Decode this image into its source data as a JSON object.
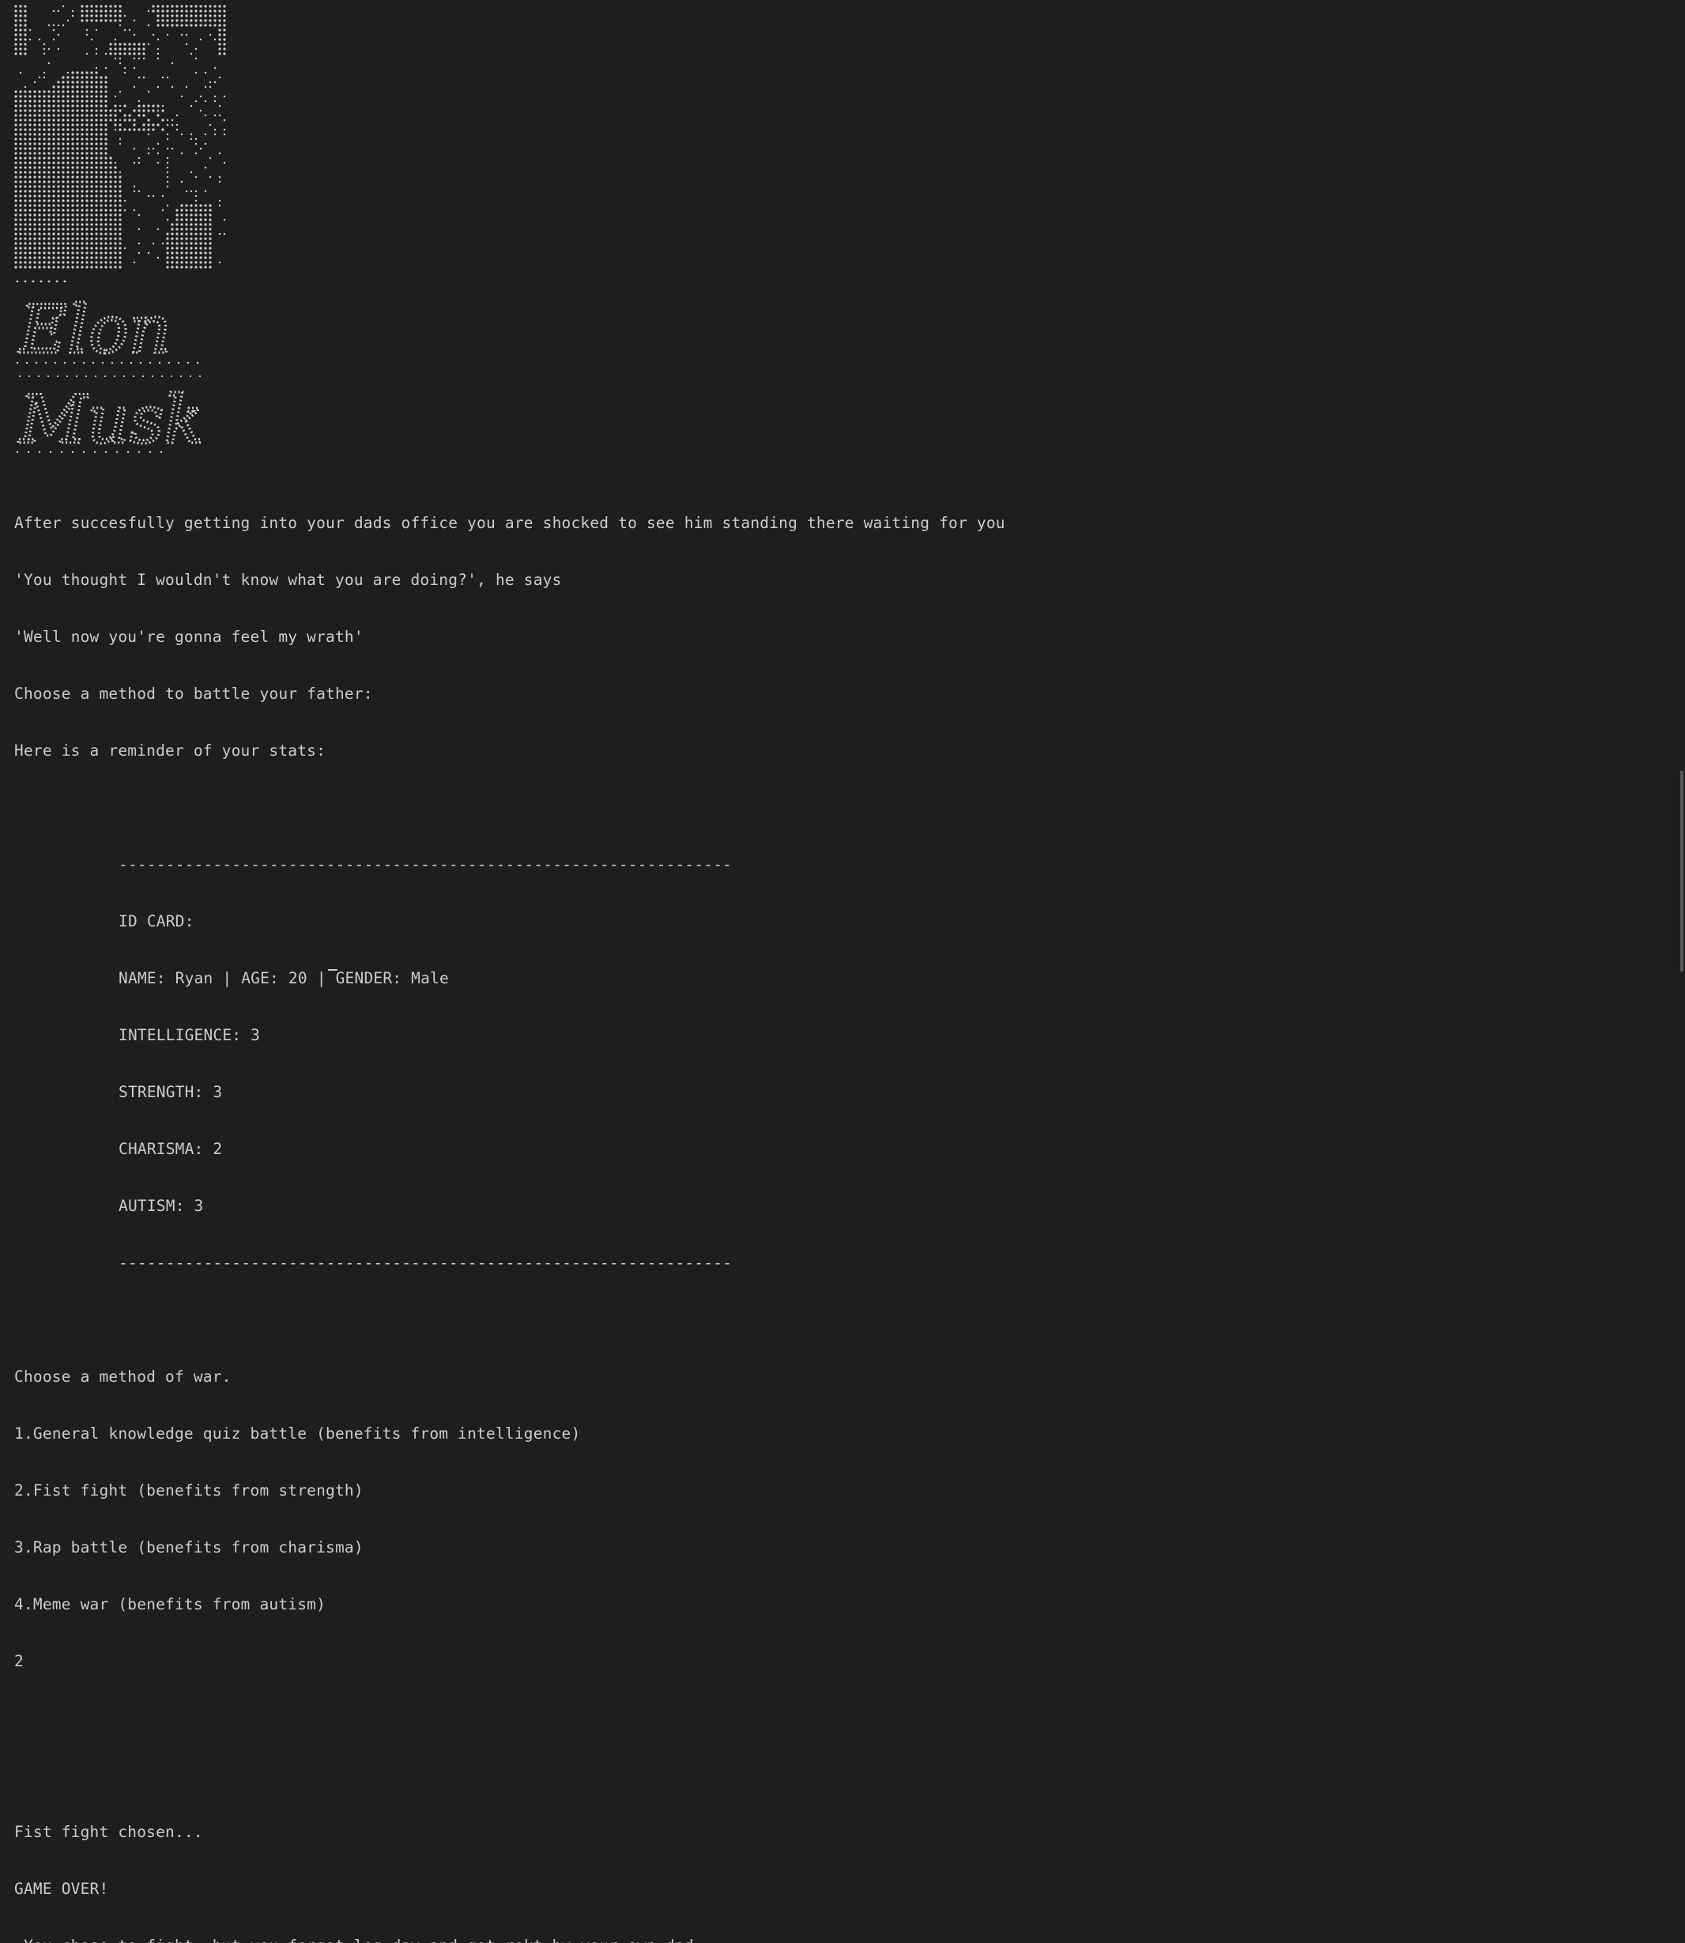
{
  "art": {
    "icon": "braille-ascii-portrait",
    "name_art_line1": "Elon",
    "name_art_line2": "Musk"
  },
  "story": {
    "line1": "After succesfully getting into your dads office you are shocked to see him standing there waiting for you",
    "line2": "'You thought I wouldn't know what you are doing?', he says",
    "line3": "'Well now you're gonna feel my wrath'",
    "line4": "Choose a method to battle your father:",
    "line5": "Here is a reminder of your stats:"
  },
  "id_card": {
    "divider": "-----------------------------------------------------------------",
    "title": "ID CARD:",
    "name_line": "NAME: Ryan | AGE: 20 | GENDER: Male",
    "intelligence": "INTELLIGENCE: 3",
    "strength": "STRENGTH: 3",
    "charisma": "CHARISMA: 2",
    "autism": "AUTISM: 3"
  },
  "menu": {
    "prompt": "Choose a method of war.",
    "options": [
      "1.General knowledge quiz battle (benefits from intelligence)",
      "2.Fist fight (benefits from strength)",
      "3.Rap battle (benefits from charisma)",
      "4.Meme war (benefits from autism)"
    ],
    "user_input": "2"
  },
  "result": {
    "chosen": "Fist fight chosen...",
    "game_over": "GAME OVER!",
    "message": " You chose to fight, but you forgot leg day and got rekt by your own dad"
  },
  "colors": {
    "background": "#1e1e1e",
    "text": "#cccccc",
    "scrollbar_thumb": "#5a5a5a"
  }
}
